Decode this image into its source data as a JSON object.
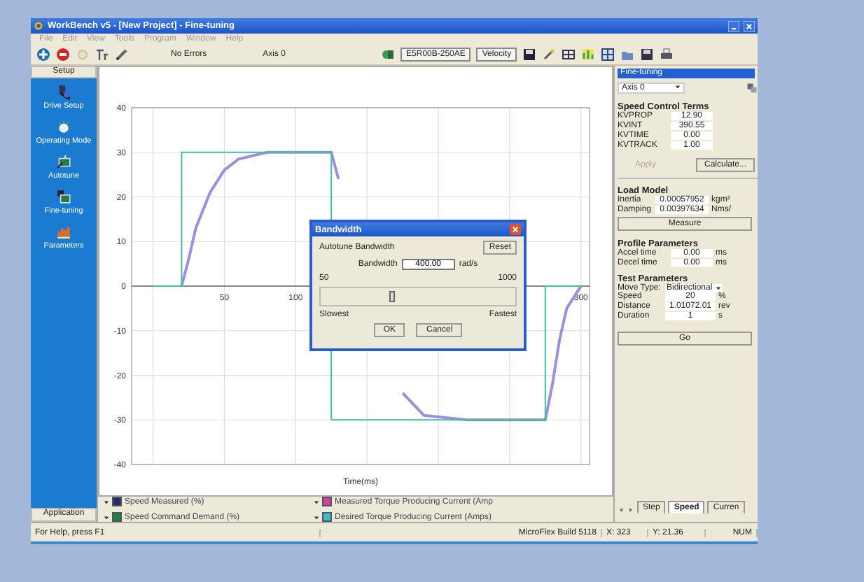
{
  "window": {
    "title": "WorkBench v5 - [New Project] - Fine-tuning"
  },
  "menu": [
    "File",
    "Edit",
    "View",
    "Tools",
    "Program",
    "Window",
    "Help"
  ],
  "toolbar": {
    "status": "No Errors",
    "axis": "Axis 0",
    "drive": "E5R00B-250AE",
    "mode": "Velocity"
  },
  "sidebar": {
    "header": "Setup",
    "footer": "Application",
    "items": [
      {
        "label": "Drive Setup"
      },
      {
        "label": "Operating Mode"
      },
      {
        "label": "Autotune"
      },
      {
        "label": "Fine-tuning"
      },
      {
        "label": "Parameters"
      }
    ]
  },
  "chart": {
    "chart_data": {
      "type": "line",
      "xlabel": "Time(ms)",
      "xlim": [
        -15,
        306
      ],
      "ylim": [
        -40,
        40
      ],
      "grid": true,
      "xticks": [
        50,
        100,
        300
      ],
      "yticks": [
        40,
        30,
        20,
        10,
        0,
        -10,
        -20,
        -30,
        -40
      ],
      "x": [
        0,
        10,
        20,
        20,
        25,
        30,
        40,
        50,
        60,
        80,
        100,
        125,
        125,
        130,
        140,
        150,
        160,
        175,
        190,
        220,
        275,
        275,
        280,
        285,
        290,
        300
      ],
      "series": [
        {
          "color": "#9d8fe0",
          "values": [
            null,
            null,
            0,
            0,
            6,
            13,
            21,
            26,
            28.5,
            30,
            30,
            30,
            30,
            24,
            null,
            null,
            null,
            -24,
            -29,
            -30,
            -30,
            -30,
            -22,
            -12,
            -5,
            0
          ]
        },
        {
          "color": "#3fc0a0",
          "values": [
            0,
            0,
            0,
            30,
            30,
            30,
            30,
            30,
            30,
            30,
            30,
            30,
            -30,
            -30,
            -30,
            -30,
            -30,
            -30,
            -30,
            -30,
            -30,
            0,
            0,
            0,
            0,
            0
          ]
        }
      ]
    }
  },
  "legend": [
    {
      "label": "Speed Measured (%)",
      "color": "#1f2f78"
    },
    {
      "label": "Measured Torque Producing Current (Amp",
      "color": "#d040a0"
    },
    {
      "label": "Speed Command Demand (%)",
      "color": "#208040"
    },
    {
      "label": "Desired Torque Producing Current (Amps)",
      "color": "#40b8d0"
    }
  ],
  "dialog": {
    "title": "Bandwidth",
    "group": "Autotune Bandwidth",
    "reset": "Reset",
    "field_label": "Bandwidth",
    "value": "400.00",
    "unit": "rad/s",
    "min": "50",
    "max": "1000",
    "level": 0.37,
    "slow": "Slowest",
    "fast": "Fastest",
    "buttons": [
      "OK",
      "Cancel"
    ]
  },
  "panel": {
    "title": "Fine-tuning",
    "axis": "Axis 0",
    "speed_control": {
      "title": "Speed Control Terms",
      "rows": [
        {
          "label": "KVPROP",
          "value": "12.90"
        },
        {
          "label": "KVINT",
          "value": "390.55"
        },
        {
          "label": "KVTIME",
          "value": "0.00"
        },
        {
          "label": "KVTRACK",
          "value": "1.00"
        }
      ]
    },
    "apply": {
      "label": "Apply",
      "disabled": true
    },
    "calculate": "Calculate...",
    "load_model": {
      "title": "Load Model",
      "rows": [
        {
          "label": "Inertia",
          "value": "0.00057952",
          "unit": "kgm²"
        },
        {
          "label": "Damping",
          "value": "0.00397634",
          "unit": "Nms/"
        }
      ]
    },
    "measure": "Measure",
    "profile": {
      "title": "Profile Parameters",
      "rows": [
        {
          "label": "Accel time",
          "value": "0.00",
          "unit": "ms"
        },
        {
          "label": "Decel time",
          "value": "0.00",
          "unit": "ms"
        }
      ]
    },
    "test": {
      "title": "Test Parameters",
      "move_type": {
        "label": "Move Type:",
        "value": "Bidirectional"
      },
      "rows": [
        {
          "label": "Speed",
          "value": "20",
          "unit": "%"
        },
        {
          "label": "Distance",
          "value": "1.01072.01",
          "unit": "rev"
        },
        {
          "label": "Duration",
          "value": "1",
          "unit": "s"
        }
      ]
    },
    "go": "Go"
  },
  "tabs": [
    {
      "label": "Step",
      "selected": false
    },
    {
      "label": "Speed",
      "selected": true
    },
    {
      "label": "Curren",
      "selected": false
    }
  ],
  "status_bar": {
    "help": "For Help, press F1",
    "build": "MicroFlex Build 5118",
    "x": "X: 323",
    "y": "Y: 21.36",
    "num": "NUM"
  }
}
